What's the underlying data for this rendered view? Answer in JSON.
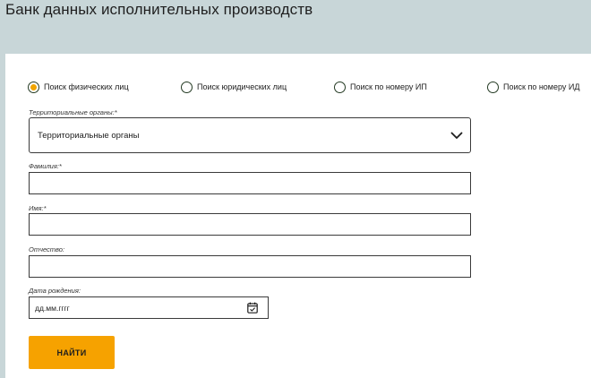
{
  "header": {
    "title": "Банк данных исполнительных производств"
  },
  "search_types": [
    {
      "label": "Поиск физических лиц",
      "checked": true
    },
    {
      "label": "Поиск юридических лиц",
      "checked": false
    },
    {
      "label": "Поиск по номеру ИП",
      "checked": false
    },
    {
      "label": "Поиск по номеру ИД",
      "checked": false
    }
  ],
  "form": {
    "territorial": {
      "label": "Территориальные органы:*",
      "value": "Территориальные органы"
    },
    "last_name": {
      "label": "Фамилия:*",
      "value": ""
    },
    "first_name": {
      "label": "Имя:*",
      "value": ""
    },
    "patronymic": {
      "label": "Отчество:",
      "value": ""
    },
    "birth_date": {
      "label": "Дата рождения:",
      "placeholder": "дд.мм.гггг"
    },
    "submit_label": "НАЙТИ"
  },
  "colors": {
    "background": "#c8d6d8",
    "accent": "#f6a200",
    "radio_border": "#243a23"
  },
  "icons": {
    "select_arrow": "chevron-down-icon",
    "date_picker": "calendar-icon"
  }
}
